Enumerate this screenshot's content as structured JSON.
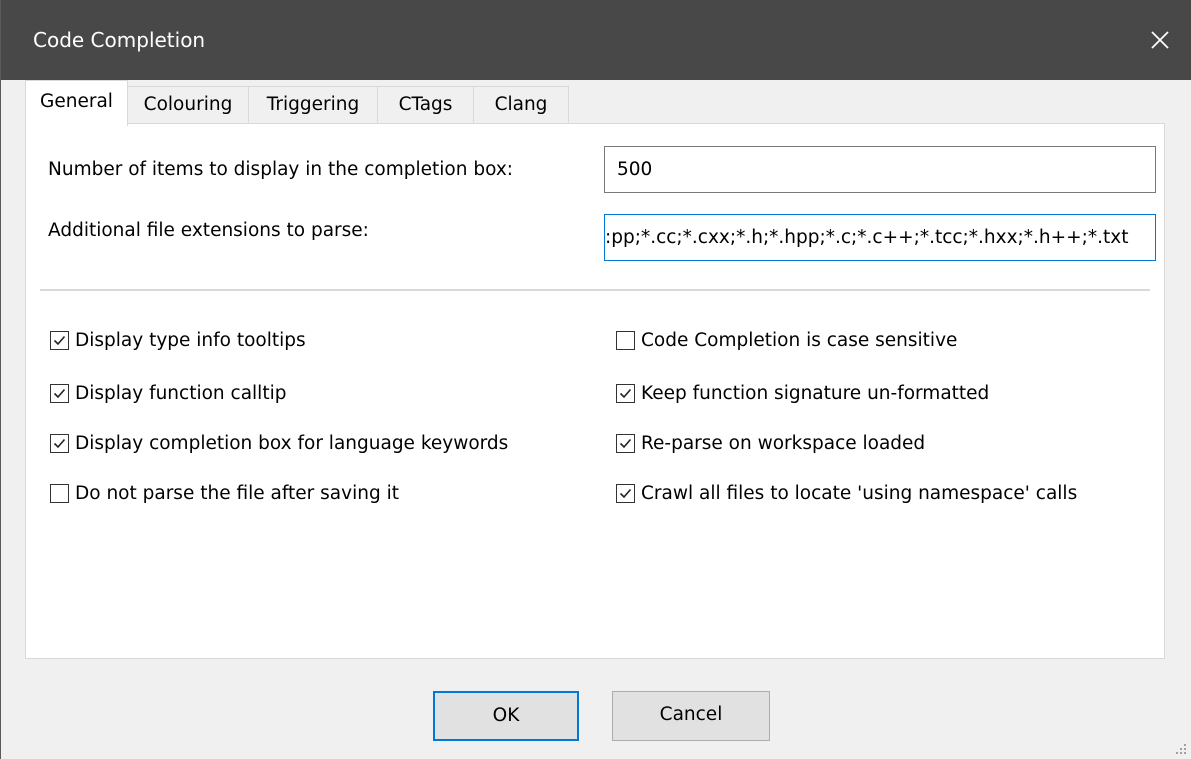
{
  "window": {
    "title": "Code Completion"
  },
  "tabs": [
    {
      "label": "General",
      "active": true
    },
    {
      "label": "Colouring",
      "active": false
    },
    {
      "label": "Triggering",
      "active": false
    },
    {
      "label": "CTags",
      "active": false
    },
    {
      "label": "Clang",
      "active": false
    }
  ],
  "general": {
    "items_label": "Number of items to display in the completion box:",
    "items_value": "500",
    "ext_label": "Additional file extensions to parse:",
    "ext_value": ":pp;*.cc;*.cxx;*.h;*.hpp;*.c;*.c++;*.tcc;*.hxx;*.h++;*.txt"
  },
  "options": [
    {
      "label": "Display type info tooltips",
      "checked": true
    },
    {
      "label": "Display function calltip",
      "checked": true
    },
    {
      "label": "Display completion box for language keywords",
      "checked": true
    },
    {
      "label": "Do not parse the file after saving it",
      "checked": false
    },
    {
      "label": "Code Completion is case sensitive",
      "checked": false
    },
    {
      "label": "Keep function signature un-formatted",
      "checked": true
    },
    {
      "label": "Re-parse on workspace loaded",
      "checked": true
    },
    {
      "label": "Crawl all files to locate 'using namespace' calls",
      "checked": true
    }
  ],
  "buttons": {
    "ok": "OK",
    "cancel": "Cancel"
  },
  "icons": {
    "close": "close-icon",
    "check": "check-icon",
    "grip": "resize-grip-icon"
  },
  "colors": {
    "titlebar": "#484848",
    "focus_border": "#0078d7",
    "dialog_bg": "#f0f0f0"
  }
}
